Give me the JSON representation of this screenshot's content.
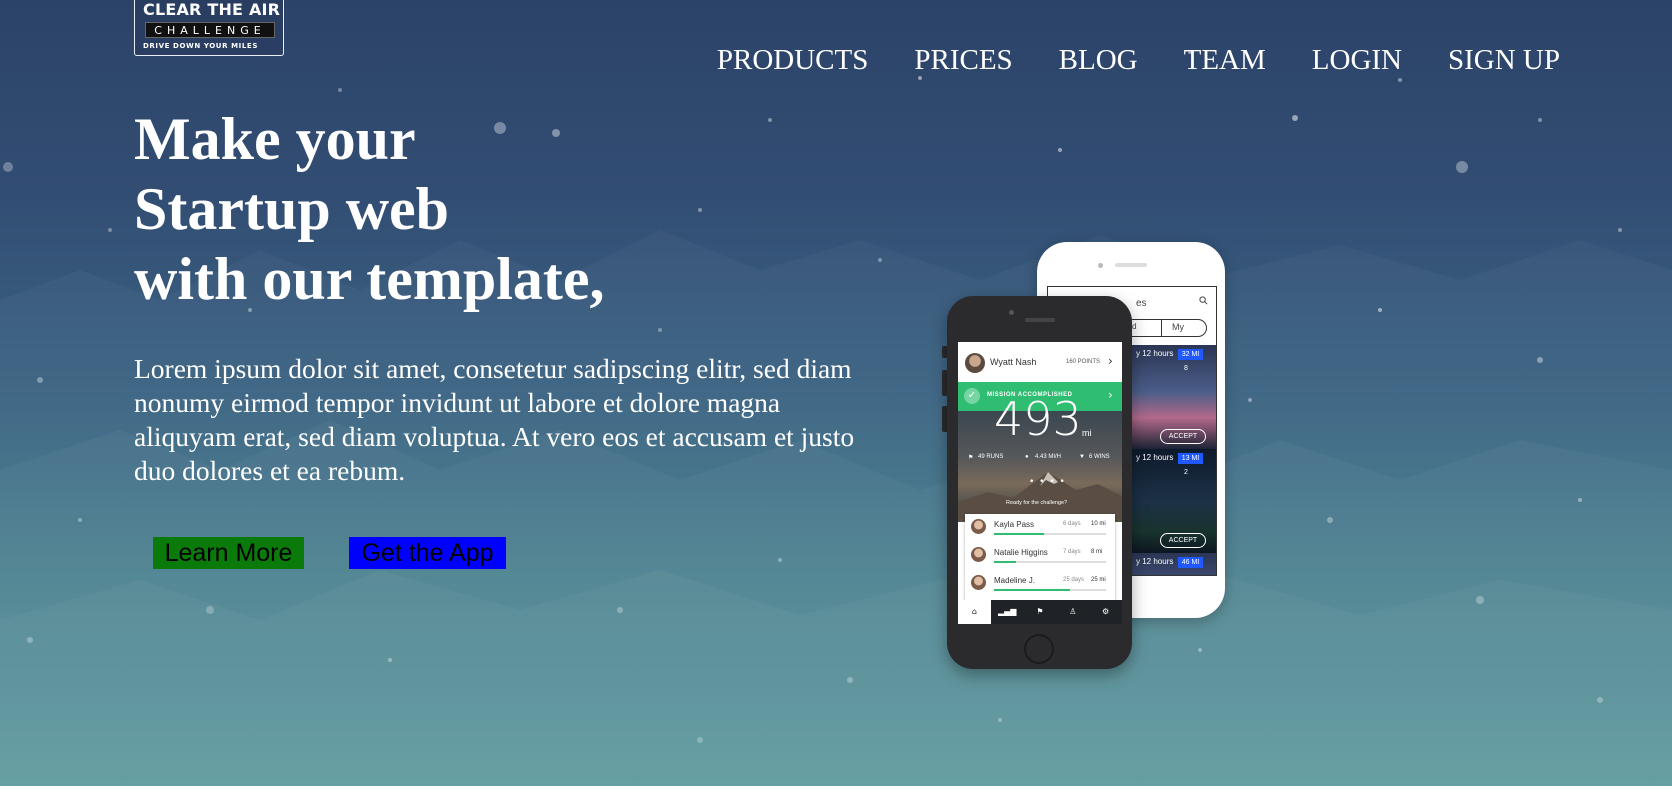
{
  "brand": {
    "line1": "CLEAR THE AIR",
    "line2": "CHALLENGE",
    "line3": "DRIVE DOWN YOUR MILES"
  },
  "nav": {
    "items": [
      "PRODUCTS",
      "PRICES",
      "BLOG",
      "TEAM",
      "LOGIN",
      "SIGN UP"
    ]
  },
  "hero": {
    "headline_lines": [
      "Make your",
      "Startup web",
      "with our template,"
    ],
    "intro": "Lorem ipsum dolor sit amet, consetetur sadipscing elitr, sed diam nonumy eirmod tempor invidunt ut labore et dolore magna aliquyam erat, sed diam voluptua. At vero eos et accusam et justo duo dolores et ea rebum.",
    "learn_more_label": "Learn More",
    "get_app_label": "Get the App"
  },
  "colors": {
    "learn_more_bg": "#0a7b0a",
    "get_app_bg": "#0000ff",
    "accent_green": "#2fbd72",
    "badge_blue": "#1f59ff"
  },
  "phone_front": {
    "user_name": "Wyatt Nash",
    "points": "160 POINTS",
    "mission": "MISSION ACCOMPLISHED",
    "distance": "493",
    "unit": "mi",
    "stat_runs": "49 RUNS",
    "stat_speed": "4.43 MI/H",
    "stat_wins": "6 WINS",
    "ready_text": "Ready for the challenge?",
    "leaders": [
      {
        "name": "Kayla Pass",
        "days": "6 days",
        "miles": "10 mi",
        "progress": 0.45
      },
      {
        "name": "Natalie Higgins",
        "days": "7 days",
        "miles": "8 mi",
        "progress": 0.2
      },
      {
        "name": "Madeline J.",
        "days": "25 days",
        "miles": "25 mi",
        "progress": 0.68
      }
    ]
  },
  "phone_back": {
    "title": "es",
    "tab_left": "d",
    "tab_right": "My",
    "card1_meta": "y 12 hours",
    "card1_badge": "32 MI",
    "card1_people": "8",
    "card2_meta": "y 12 hours",
    "card2_badge": "13 MI",
    "card2_people": "2",
    "card3_meta": "y 12 hours",
    "card3_badge": "46 MI",
    "accept_label": "ACCEPT"
  }
}
